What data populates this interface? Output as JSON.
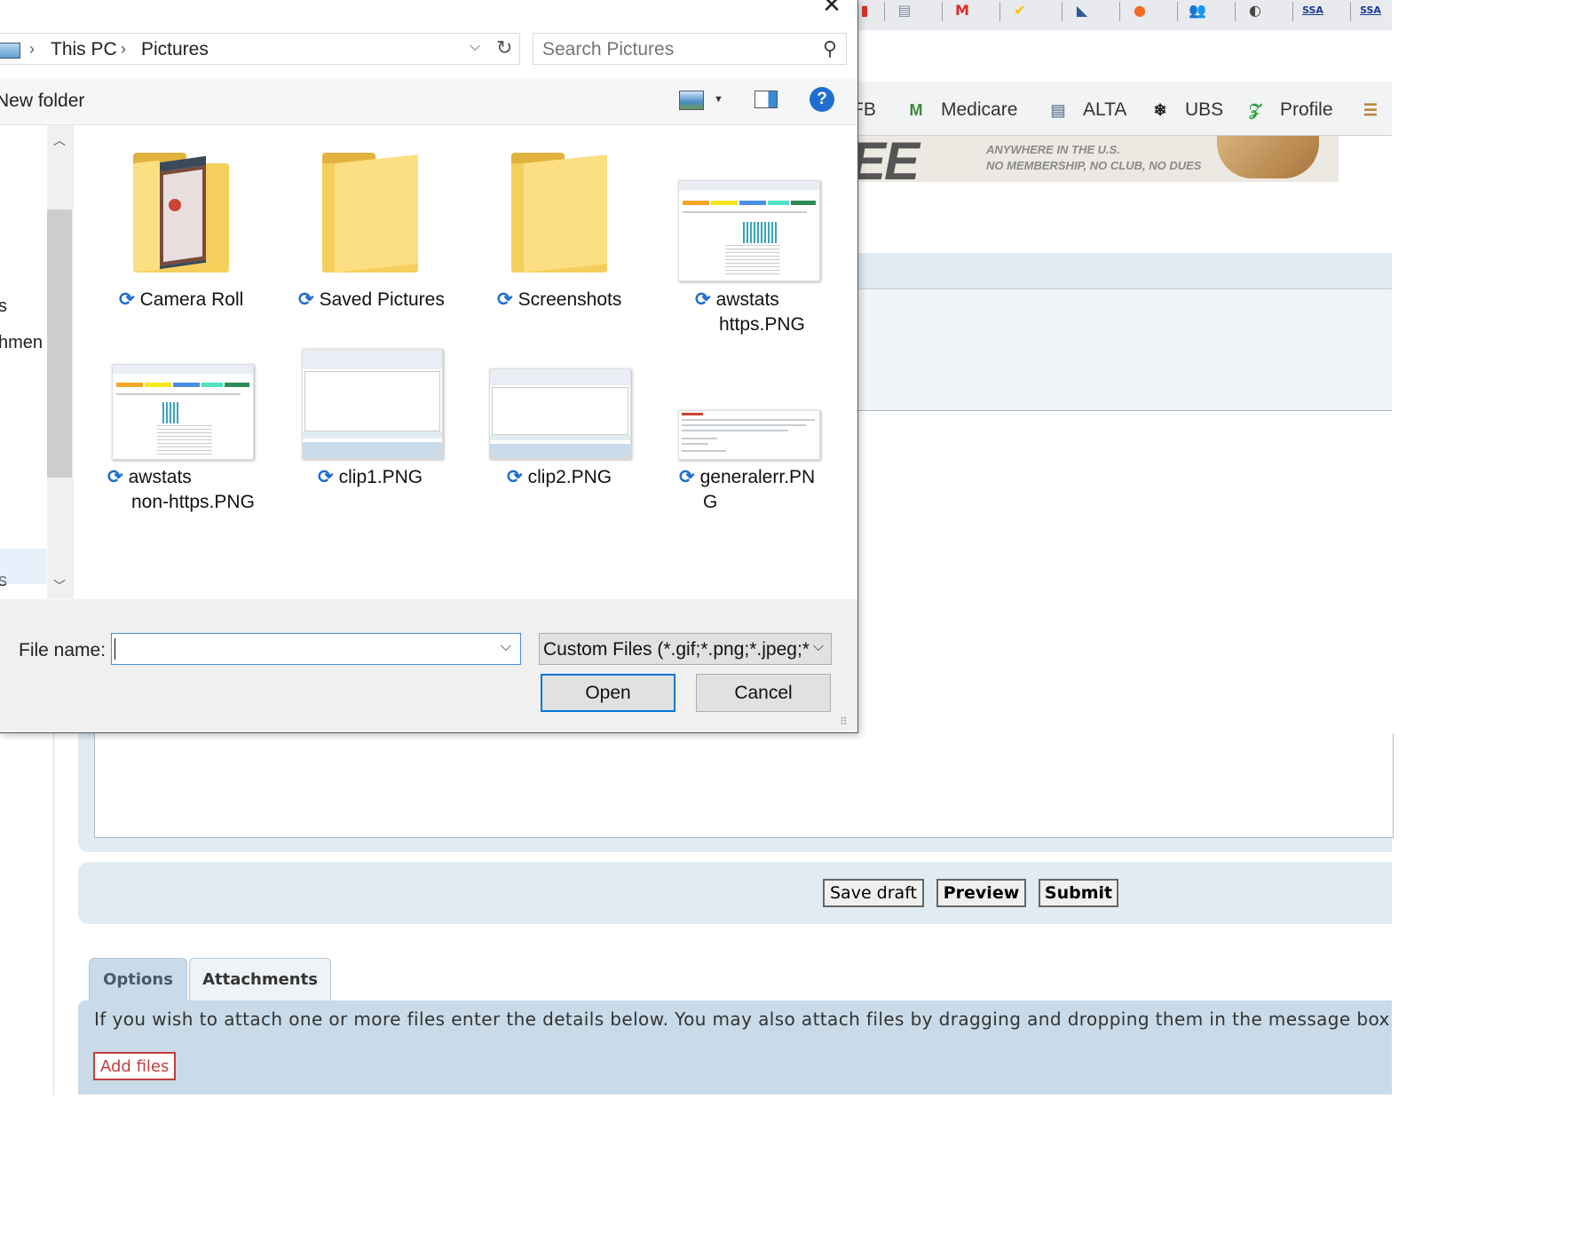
{
  "browser": {
    "extensions": [
      {
        "name": "red-extension-icon",
        "glyph": "▮",
        "color": "#d93025"
      },
      {
        "name": "document-extension-icon",
        "glyph": "▤",
        "color": "#7b8ea8"
      },
      {
        "name": "gmail-icon",
        "glyph": "M",
        "color": "#d93025"
      },
      {
        "name": "norton-icon",
        "glyph": "✔",
        "color": "#f2c200"
      },
      {
        "name": "bookmark-extension-icon",
        "glyph": "◣",
        "color": "#2b5aa0"
      },
      {
        "name": "orange-extension-icon",
        "glyph": "●",
        "color": "#f26a21"
      },
      {
        "name": "people-icon",
        "glyph": "👥",
        "color": "#4a6fa5"
      },
      {
        "name": "globe-icon",
        "glyph": "◐",
        "color": "#444"
      },
      {
        "name": "ssa-icon-1",
        "glyph": "SSA",
        "color": "#1a3a9a"
      },
      {
        "name": "ssa-icon-2",
        "glyph": "SSA",
        "color": "#1a3a9a"
      }
    ],
    "bookmarks": [
      {
        "label": "FB",
        "icon_color": "#3b5998",
        "glyph": ""
      },
      {
        "label": "Medicare",
        "icon_color": "#3b8a3b",
        "glyph": "M"
      },
      {
        "label": "ALTA",
        "icon_color": "#7b8ea8",
        "glyph": "▤"
      },
      {
        "label": "UBS",
        "icon_color": "#222",
        "glyph": "❄"
      },
      {
        "label": "Profile",
        "icon_color": "#2a9d3a",
        "glyph": "𝒵"
      },
      {
        "label": "",
        "icon_color": "#b8863b",
        "glyph": "☰"
      }
    ],
    "banner": {
      "big_text": "EE",
      "line1": "ANYWHERE IN THE U.S.",
      "line2": "NO MEMBERSHIP, NO CLUB, NO DUES"
    },
    "post_buttons": {
      "save_draft": "Save draft",
      "preview": "Preview",
      "submit": "Submit"
    },
    "tabs": {
      "options": "Options",
      "attachments": "Attachments"
    },
    "attach_text": "If you wish to attach one or more files enter the details below. You may also attach files by dragging and dropping them in the message box.",
    "add_files": "Add files"
  },
  "dialog": {
    "close_glyph": "✕",
    "breadcrumb": [
      "This PC",
      "Pictures"
    ],
    "search_placeholder": "Search Pictures",
    "new_folder": "New folder",
    "help_glyph": "?",
    "nav_fragments": [
      "s",
      "hmen",
      "s",
      "‚"
    ],
    "items": [
      {
        "type": "folder-photo",
        "label": [
          "Camera Roll"
        ]
      },
      {
        "type": "folder",
        "label": [
          "Saved Pictures"
        ]
      },
      {
        "type": "folder",
        "label": [
          "Screenshots"
        ]
      },
      {
        "type": "image",
        "label": [
          "awstats",
          "https.PNG"
        ]
      },
      {
        "type": "image",
        "label": [
          "awstats",
          "non-https.PNG"
        ]
      },
      {
        "type": "image",
        "label": [
          "clip1.PNG"
        ]
      },
      {
        "type": "image",
        "label": [
          "clip2.PNG"
        ]
      },
      {
        "type": "image",
        "label": [
          "generalerr.PN",
          "G"
        ]
      }
    ],
    "file_name_label": "File name:",
    "file_name_value": "",
    "file_type": "Custom Files (*.gif;*.png;*.jpeg;*",
    "open_label": "Open",
    "cancel_label": "Cancel"
  }
}
